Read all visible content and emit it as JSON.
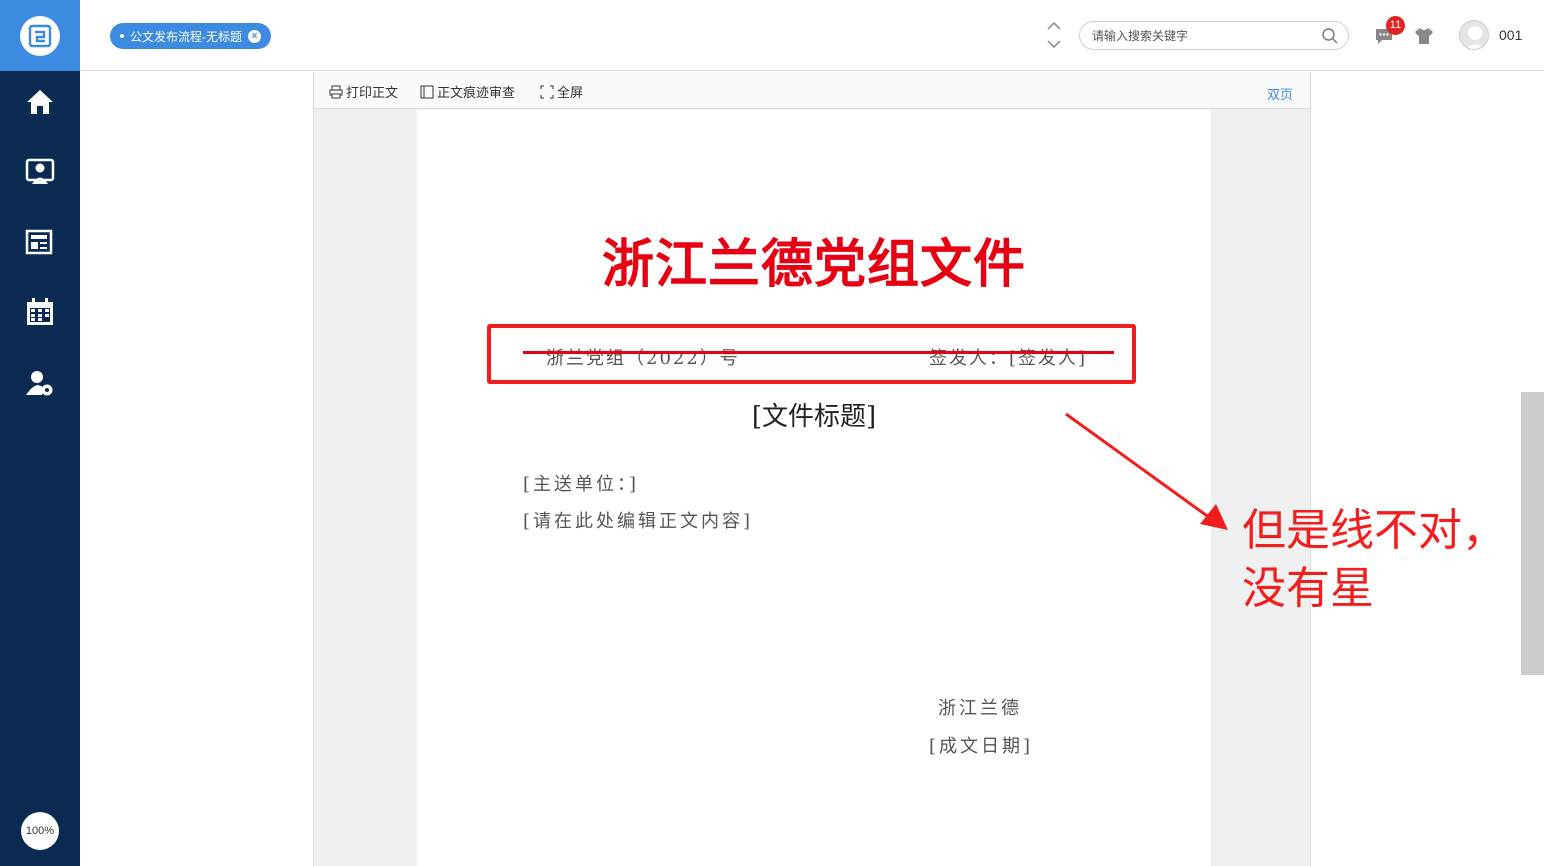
{
  "sidebar": {
    "items": [
      {
        "name": "home",
        "icon": "home-icon"
      },
      {
        "name": "contacts",
        "icon": "user-card-icon"
      },
      {
        "name": "news",
        "icon": "newspaper-icon"
      },
      {
        "name": "calendar",
        "icon": "calendar-icon"
      },
      {
        "name": "user-settings",
        "icon": "user-gear-icon"
      }
    ],
    "zoom_label": "100%"
  },
  "topbar": {
    "tab_label": "公文发布流程-无标题",
    "search_placeholder": "请输入搜索关键字",
    "message_count": "11",
    "username": "001"
  },
  "viewer": {
    "toolbar": {
      "print_label": "打印正文",
      "track_label": "正文痕迹审查",
      "fullscreen_label": "全屏",
      "double_page_label": "双页"
    }
  },
  "document": {
    "header": "浙江兰德党组文件",
    "number": "浙兰党组（2022）号",
    "signer": "签发人：[签发人]",
    "title": "[文件标题]",
    "recipient": "[主送单位：]",
    "body": "[请在此处编辑正文内容]",
    "org": "浙江兰德",
    "date": "[成文日期]",
    "accent_color": "#e60012"
  },
  "annotation": {
    "line1": "但是线不对，",
    "line2": "没有星",
    "color": "#f21d1d"
  },
  "colors": {
    "sidebar_bg": "#0b2a52",
    "brand_blue": "#3c8be0",
    "badge_red": "#e02424"
  }
}
